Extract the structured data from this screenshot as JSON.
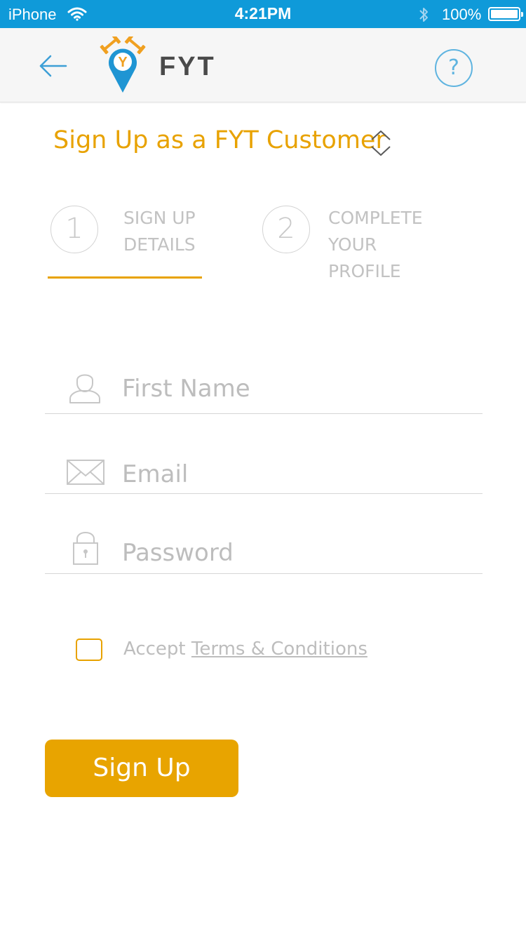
{
  "status_bar": {
    "carrier": "iPhone",
    "time": "4:21PM",
    "battery": "100%"
  },
  "nav": {
    "brand": "FYT",
    "help_symbol": "?",
    "back_icon": "arrow-left-icon",
    "logo_icon": "fyt-logo-icon",
    "help_icon": "question-icon"
  },
  "heading": {
    "title": "Sign Up as a FYT Customer",
    "toggle_icon": "chevron-up-down-icon"
  },
  "steps": [
    {
      "number": "1",
      "line1": "SIGN UP",
      "line2": "DETAILS",
      "active": true
    },
    {
      "number": "2",
      "line1": "COMPLETE",
      "line2": "YOUR PROFILE",
      "active": false
    }
  ],
  "form": {
    "first_name": {
      "placeholder": "First Name",
      "value": "",
      "icon": "user-icon"
    },
    "email": {
      "placeholder": "Email",
      "value": "",
      "icon": "envelope-icon"
    },
    "password": {
      "placeholder": "Password",
      "value": "",
      "icon": "lock-icon"
    }
  },
  "terms": {
    "prefix": "Accept ",
    "link": "Terms & Conditions",
    "checked": false
  },
  "submit": {
    "label": "Sign Up"
  },
  "colors": {
    "status_bar": "#0f9ad9",
    "accent": "#e8a200",
    "link_blue": "#5fb4e0"
  }
}
